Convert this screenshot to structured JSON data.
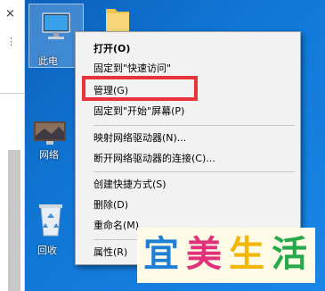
{
  "explorer": {
    "close_glyph": "×",
    "dots": "⋮"
  },
  "desktop_icons": {
    "this_pc": "此电",
    "network": "网络",
    "recycle_bin": "回收"
  },
  "context_menu": {
    "items": [
      "打开(O)",
      "固定到\"快速访问\"",
      "管理(G)",
      "固定到\"开始\"屏幕(P)",
      "映射网络驱动器(N)...",
      "断开网络驱动器的连接(C)...",
      "创建快捷方式(S)",
      "删除(D)",
      "重命名(M)",
      "属性(R)"
    ]
  },
  "watermark": {
    "chars": [
      "宜",
      "美",
      "生",
      "活"
    ]
  },
  "colors": {
    "highlight": "#e8323c",
    "wm_blue": "#1e7fd6",
    "wm_pink": "#e0317a",
    "wm_yellow": "#f2b705",
    "wm_green": "#26a84b"
  }
}
